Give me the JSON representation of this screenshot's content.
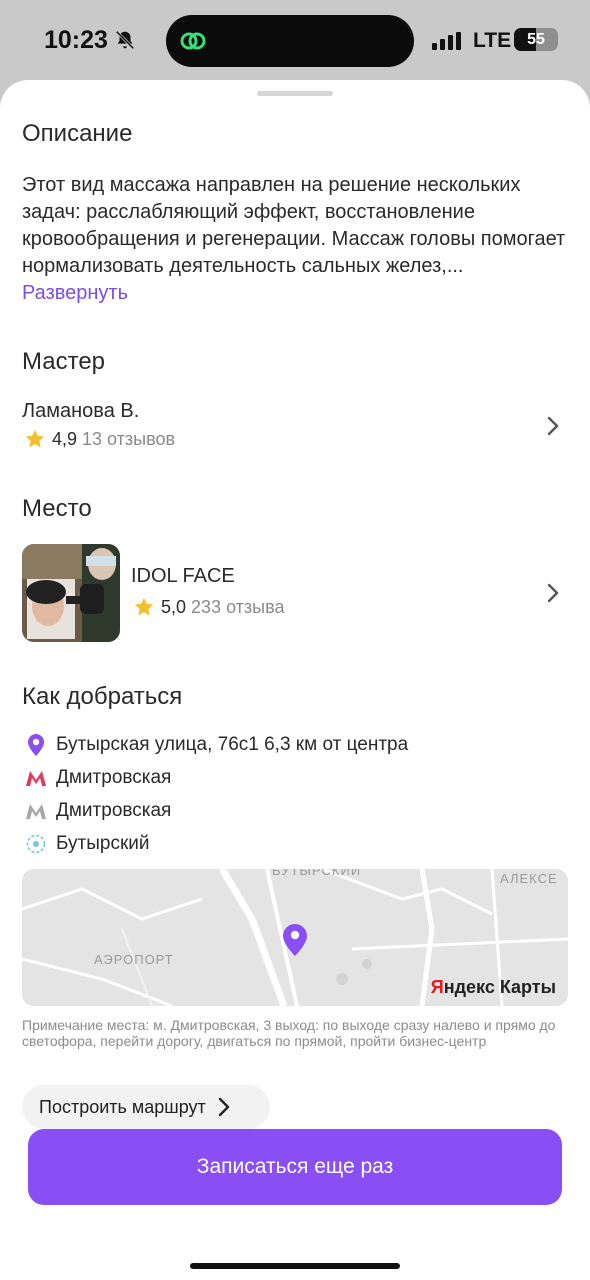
{
  "status_bar": {
    "time": "10:23",
    "network": "LTE",
    "battery": "55"
  },
  "description": {
    "title": "Описание",
    "text": "Этот вид массажа направлен на решение нескольких задач: расслабляющий эффект, восстановление кровообращения и регенерации. Массаж головы помогает нормализовать деятельность сальных желез,...",
    "expand_label": "Развернуть"
  },
  "master": {
    "title": "Мастер",
    "name": "Ламанова В.",
    "rating": "4,9",
    "reviews": "13 отзывов"
  },
  "place": {
    "title": "Место",
    "name": "IDOL FACE",
    "rating": "5,0",
    "reviews": "233 отзыва"
  },
  "directions": {
    "title": "Как добраться",
    "address": "Бутырская улица, 76с1 6,3 км от центра",
    "metro_1": "Дмитровская",
    "metro_2": "Дмитровская",
    "station": "Бутырский",
    "map": {
      "label_top": "БУТЫРСКИЙ",
      "label_right": "АЛЕКСЕ",
      "label_left": "АЭРОПОРТ",
      "brand_y": "Я",
      "brand_rest": "ндекс Карты"
    },
    "note": "Примечание места: м. Дмитровская, 3 выход: по выходе сразу налево и прямо до светофора, перейти дорогу, двигаться по прямой, пройти бизнес-центр",
    "route_button": "Построить маршрут"
  },
  "cta_label": "Записаться еще раз",
  "colors": {
    "accent": "#8a4ff4",
    "link": "#7b4ce6",
    "star": "#f5c02e",
    "metro_red": "#e03a5a"
  }
}
